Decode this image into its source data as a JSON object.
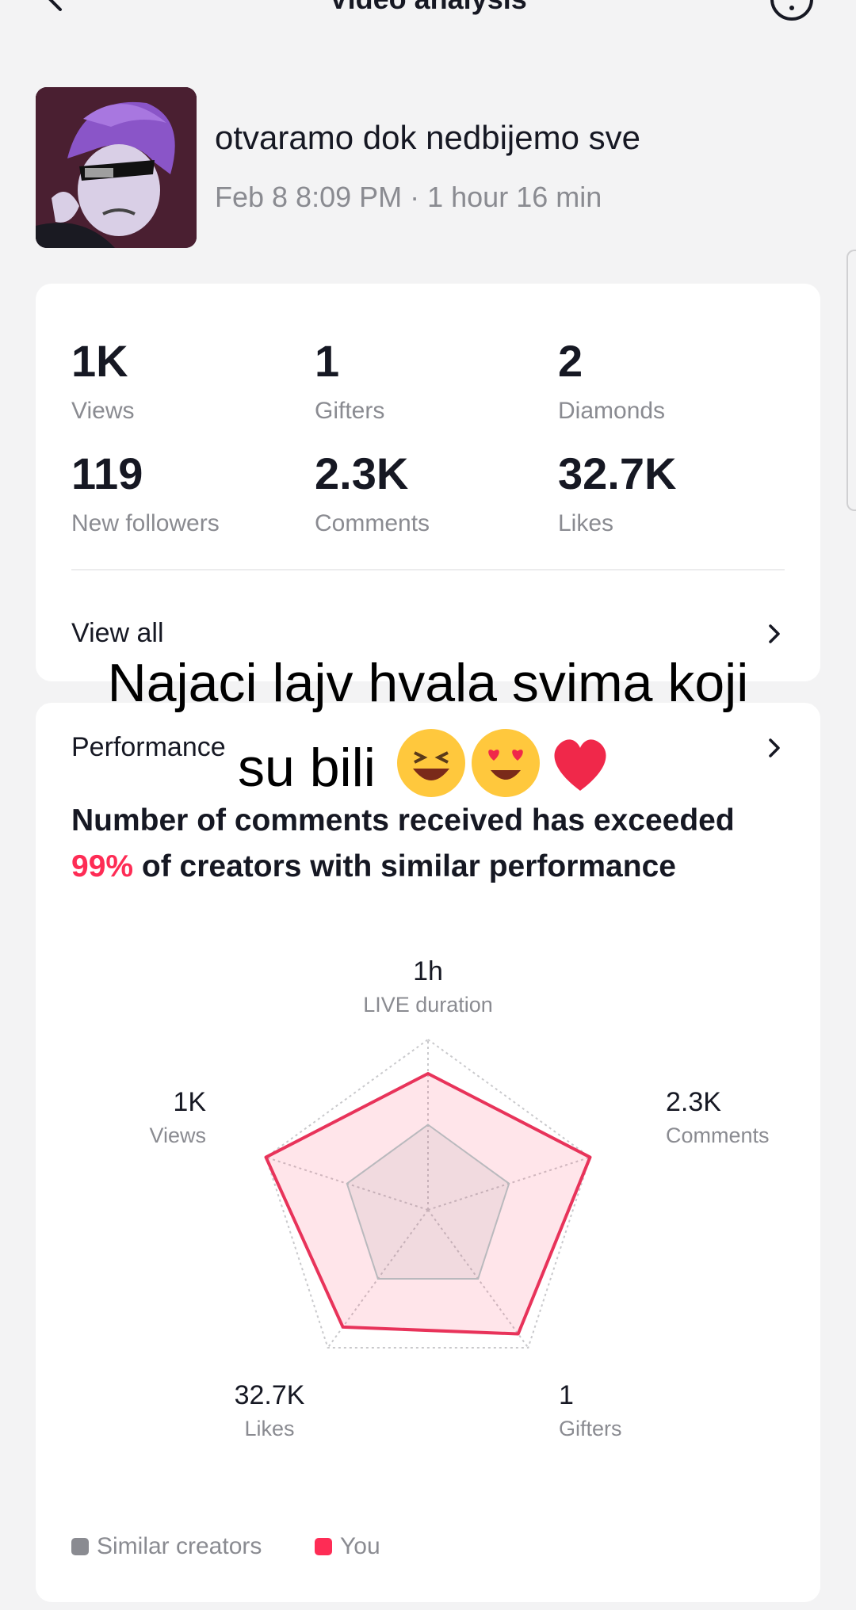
{
  "nav": {
    "title": "Video analysis"
  },
  "video": {
    "title": "otvaramo dok nedbijemo sve",
    "meta": "Feb 8 8:09 PM · 1 hour 16 min"
  },
  "stats": [
    {
      "value": "1K",
      "label": "Views"
    },
    {
      "value": "1",
      "label": "Gifters"
    },
    {
      "value": "2",
      "label": "Diamonds"
    },
    {
      "value": "119",
      "label": "New followers"
    },
    {
      "value": "2.3K",
      "label": "Comments"
    },
    {
      "value": "32.7K",
      "label": "Likes"
    }
  ],
  "view_all_label": "View all",
  "performance": {
    "label": "Performance",
    "desc_before": "Number of comments received has exceeded ",
    "desc_highlight": "99%",
    "desc_after": " of creators with similar performance"
  },
  "radar": {
    "axes": [
      {
        "value": "1h",
        "label": "LIVE duration"
      },
      {
        "value": "2.3K",
        "label": "Comments"
      },
      {
        "value": "1",
        "label": "Gifters"
      },
      {
        "value": "32.7K",
        "label": "Likes"
      },
      {
        "value": "1K",
        "label": "Views"
      }
    ],
    "you_levels": [
      0.8,
      1.0,
      0.9,
      0.85,
      1.0
    ],
    "similar_levels": [
      0.5,
      0.5,
      0.5,
      0.5,
      0.5
    ]
  },
  "legend": {
    "similar": "Similar creators",
    "you": "You"
  },
  "caption": {
    "line1": "Najaci lajv hvala svima koji",
    "line2": "su bili"
  },
  "colors": {
    "accent": "#fe2c55",
    "similar": "#8a8b91",
    "background": "#f3f3f4"
  }
}
